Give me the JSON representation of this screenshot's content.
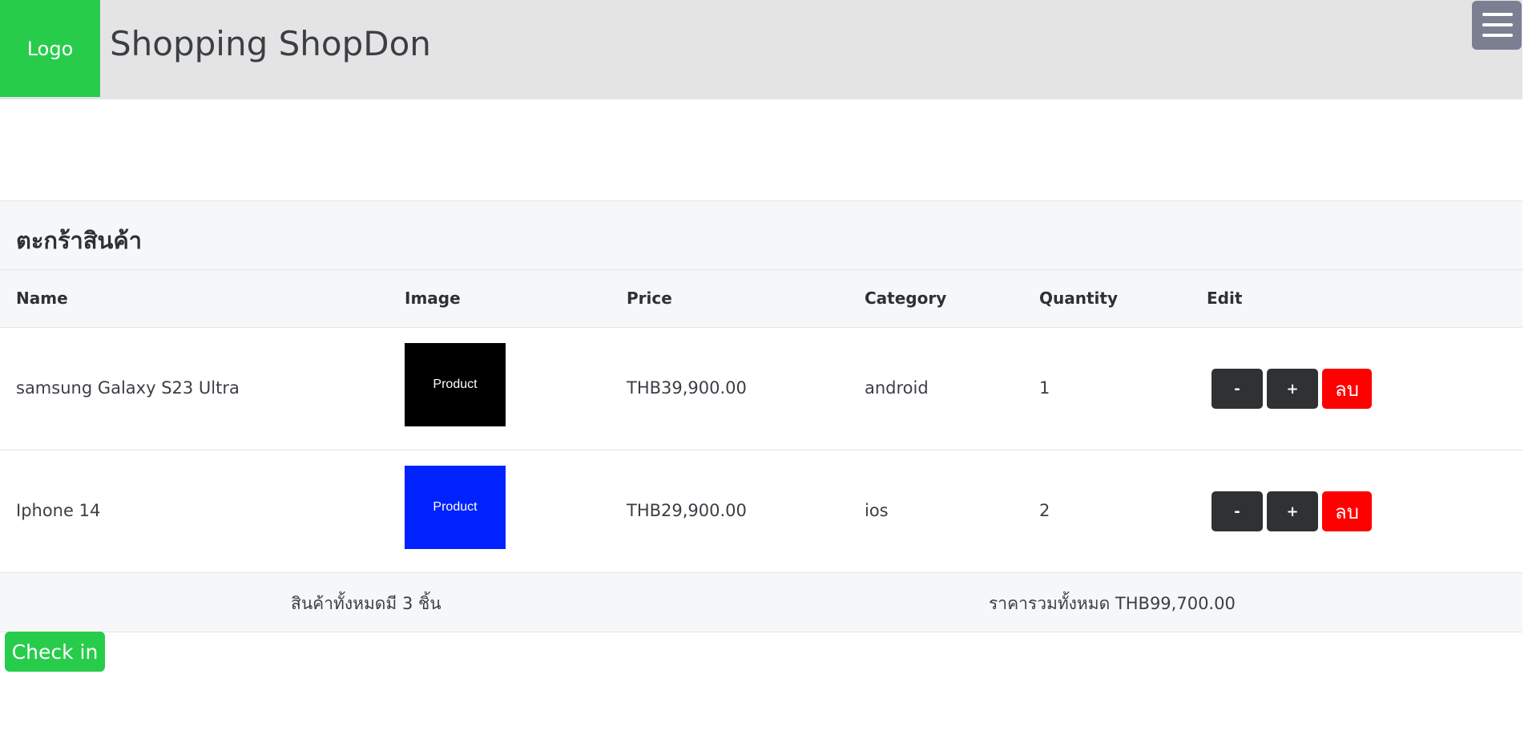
{
  "header": {
    "logo": "Logo",
    "title": "Shopping ShopDon",
    "menu_icon": "hamburger-menu-icon"
  },
  "cart": {
    "title": "ตะกร้าสินค้า",
    "columns": [
      "Name",
      "Image",
      "Price",
      "Category",
      "Quantity",
      "Edit"
    ],
    "rows": [
      {
        "name": "samsung Galaxy S23 Ultra",
        "image_label": "Product",
        "image_color": "#000000",
        "price": "THB39,900.00",
        "category": "android",
        "quantity": "1",
        "minus_label": "-",
        "plus_label": "+",
        "delete_label": "ลบ"
      },
      {
        "name": "Iphone 14",
        "image_label": "Product",
        "image_color": "#0022ff",
        "price": "THB29,900.00",
        "category": "ios",
        "quantity": "2",
        "minus_label": "-",
        "plus_label": "+",
        "delete_label": "ลบ"
      }
    ],
    "footer": {
      "total_items": "สินค้าทั้งหมดมี 3 ชิ้น",
      "total_price": "ราคารวมทั้งหมด THB99,700.00"
    }
  },
  "checkin_label": "Check in",
  "colors": {
    "brand_green": "#28cc4b",
    "delete_red": "#ff0000",
    "dark_button": "#2f3133",
    "header_bg": "#e4e4e4"
  }
}
